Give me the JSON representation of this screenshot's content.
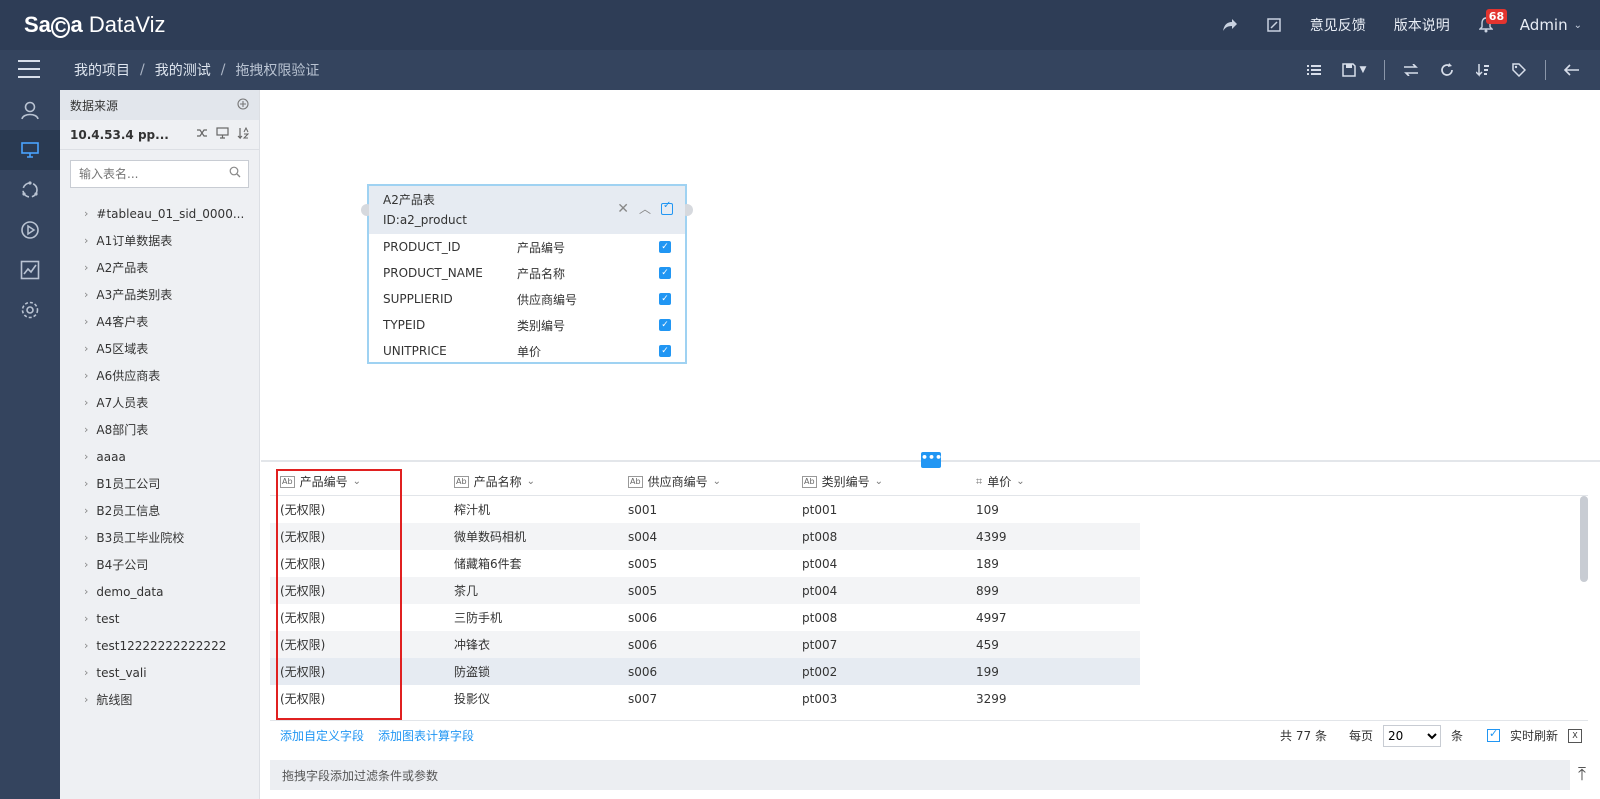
{
  "app": {
    "logo_a": "Sa",
    "logo_b": "C",
    "logo_c": "a",
    "logo_d": " DataViz"
  },
  "topbar": {
    "feedback": "意见反馈",
    "release_notes": "版本说明",
    "notification_count": "68",
    "user": "Admin"
  },
  "breadcrumb": [
    "我的项目",
    "我的测试",
    "拖拽权限验证"
  ],
  "datasource": {
    "header": "数据来源",
    "connection": "10.4.53.4 pp...",
    "search_placeholder": "输入表名...",
    "tables": [
      "#tableau_01_sid_0000...",
      "A1订单数据表",
      "A2产品表",
      "A3产品类别表",
      "A4客户表",
      "A5区域表",
      "A6供应商表",
      "A7人员表",
      "A8部门表",
      "aaaa",
      "B1员工公司",
      "B2员工信息",
      "B3员工毕业院校",
      "B4子公司",
      "demo_data",
      "test",
      "test12222222222222",
      "test_vali",
      "航线图"
    ]
  },
  "card": {
    "title": "A2产品表",
    "id": "ID:a2_product",
    "fields": [
      {
        "name": "PRODUCT_ID",
        "alias": "产品编号"
      },
      {
        "name": "PRODUCT_NAME",
        "alias": "产品名称"
      },
      {
        "name": "SUPPLIERID",
        "alias": "供应商编号"
      },
      {
        "name": "TYPEID",
        "alias": "类别编号"
      },
      {
        "name": "UNITPRICE",
        "alias": "单价"
      }
    ]
  },
  "grid": {
    "columns": [
      {
        "label": "产品编号",
        "type": "Ab"
      },
      {
        "label": "产品名称",
        "type": "Ab"
      },
      {
        "label": "供应商编号",
        "type": "Ab"
      },
      {
        "label": "类别编号",
        "type": "Ab"
      },
      {
        "label": "单价",
        "type": "number"
      }
    ],
    "rows": [
      [
        "(无权限)",
        "榨汁机",
        "s001",
        "pt001",
        "109"
      ],
      [
        "(无权限)",
        "微单数码相机",
        "s004",
        "pt008",
        "4399"
      ],
      [
        "(无权限)",
        "储藏箱6件套",
        "s005",
        "pt004",
        "189"
      ],
      [
        "(无权限)",
        "茶几",
        "s005",
        "pt004",
        "899"
      ],
      [
        "(无权限)",
        "三防手机",
        "s006",
        "pt008",
        "4997"
      ],
      [
        "(无权限)",
        "冲锋衣",
        "s006",
        "pt007",
        "459"
      ],
      [
        "(无权限)",
        "防盗锁",
        "s006",
        "pt002",
        "199"
      ],
      [
        "(无权限)",
        "投影仪",
        "s007",
        "pt003",
        "3299"
      ]
    ]
  },
  "footer": {
    "add_custom_field": "添加自定义字段",
    "add_calc_field": "添加图表计算字段",
    "total": "共 77 条",
    "per_page_label": "每页",
    "per_page_value": "20",
    "per_page_unit": "条",
    "realtime": "实时刷新"
  },
  "filter_bar": {
    "hint": "拖拽字段添加过滤条件或参数"
  },
  "colors": {
    "topbar": "#2e3d56",
    "accent": "#2196f3",
    "permission_box": "#e02020",
    "badge": "#e3342f"
  }
}
